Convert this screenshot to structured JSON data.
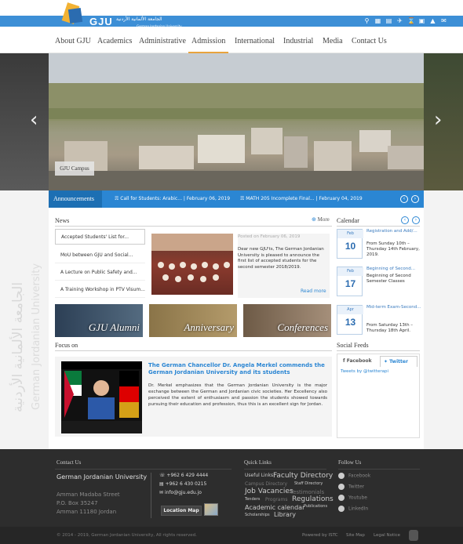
{
  "logo": {
    "abbr": "GJU",
    "arabic_name": "الجامعة الألمانية الأردنية",
    "english_name": "German Jordanian University"
  },
  "top_icons": [
    "search-icon",
    "calendar-icon",
    "books-icon",
    "plane-icon",
    "hourglass-icon",
    "building-icon",
    "graduation-icon",
    "mail-icon"
  ],
  "nav": {
    "items": [
      "About GJU",
      "Academics",
      "Administrative",
      "Admission",
      "International",
      "Industrial",
      "Media",
      "Contact Us"
    ],
    "active": "Admission"
  },
  "slider": {
    "caption": "GJU Campus",
    "prev": "‹",
    "next": "›"
  },
  "announcements": {
    "label": "Announcements",
    "items": [
      "Call for Students: Arabic... | February 06, 2019",
      "MATH 205 Incomplete Final... | February 04, 2019"
    ]
  },
  "watermark": {
    "arabic": "الجامعة الألمانية الأردنية",
    "english": "German Jordanian University"
  },
  "news": {
    "heading": "News",
    "more": "More",
    "items": [
      "Accepted Students' List for...",
      "MoU between GJU and Social...",
      "A Lecture on Public Safety and...",
      "A Training Workshop in PTV Visum..."
    ],
    "featured": {
      "date": "Posted on February 06, 2019",
      "text": "Dear new GJU'ts, The German Jordanian University is pleased to announce the first list of accepted students for the second semester 2018/2019.",
      "read_more": "Read more"
    }
  },
  "calendar": {
    "heading": "Calendar",
    "events": [
      {
        "month": "Feb",
        "day": "10",
        "title": "Registration and Add/...",
        "sub": "From Sunday 10th – Thursday 14th February, 2019."
      },
      {
        "month": "Feb",
        "day": "17",
        "title": "Beginning of Second...",
        "sub": "Beginning of Second Semester Classes"
      },
      {
        "month": "Apr",
        "day": "13",
        "title": "Mid-term Exam-Second...",
        "sub": "From Saturday 13th – Thursday 18th April."
      }
    ]
  },
  "banners": [
    "GJU Alumni",
    "Anniversary",
    "Conferences"
  ],
  "focus": {
    "heading": "Focus on",
    "title": "The German Chancellor Dr. Angela Merkel commends the German Jordanian University and its students",
    "text": "Dr. Merkel emphasizes that the German Jordanian University is the major exchange between the German and Jordanian civic societies. Her Excellency also perceived the extent of enthusiasm and passion the students showed towards pursuing their education and profession, thus this is an excellent sign for Jordan."
  },
  "social_feeds": {
    "heading": "Social Feeds",
    "tab_facebook": "Facebook",
    "tab_twitter": "Twitter",
    "tweets_link": "Tweets by @twitterapi"
  },
  "footer": {
    "contact_heading": "Contact Us",
    "university": "German Jordanian University",
    "address": [
      "Amman Madaba Street",
      "P.O. Box 35247",
      "Amman 11180 Jordan"
    ],
    "phone": "+962 6 429 4444",
    "fax": "+962 6 430 0215",
    "email": "info@gju.edu.jo",
    "location_map": "Location Map",
    "quick_links_heading": "Quick Links",
    "quick_links": [
      "Useful Links",
      "Faculty Directory",
      "Campus Directory",
      "Staff Directory",
      "Job Vacancies",
      "Testimonials",
      "Tenders",
      "Programs",
      "Regulations",
      "Academic calendar",
      "Publications",
      "Scholarships",
      "Library"
    ],
    "follow_heading": "Follow Us",
    "follow": [
      "Facebook",
      "Twitter",
      "Youtube",
      "LinkedIn"
    ],
    "copyright": "© 2014 - 2019, German Jordanian University, All rights reserved.",
    "powered": "Powered by ISTC",
    "site_map": "Site Map",
    "legal": "Legal Notice"
  },
  "colors": {
    "brand_blue": "#3d8fd6",
    "announce_blue": "#2b86d3",
    "accent_orange": "#e8a33d",
    "footer_bg": "#2d2d2d"
  }
}
